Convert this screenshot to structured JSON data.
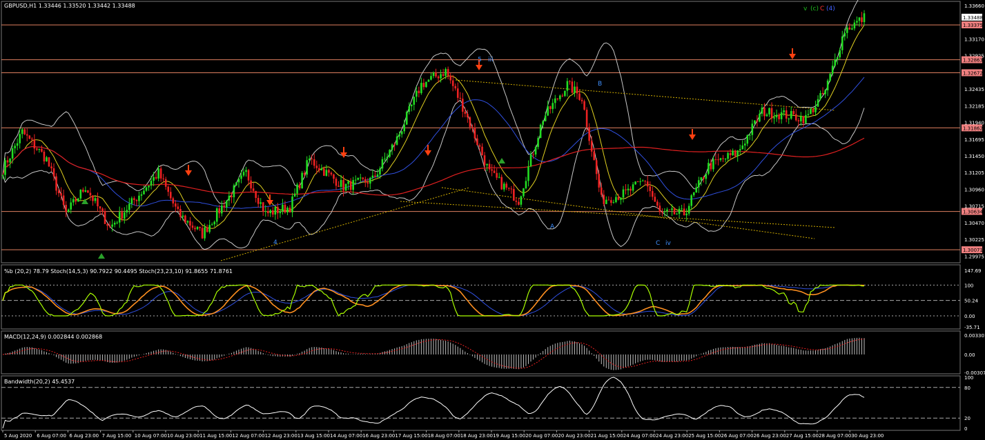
{
  "header": {
    "symbol_info": "GBPUSD,H1  1.33446 1.33520 1.33442 1.33488",
    "wave_count": [
      "v",
      "(c)",
      "C",
      "(4)"
    ],
    "wave_colors": [
      "#1fbf1f",
      "#1fbf1f",
      "#ff3030",
      "#4060ff"
    ]
  },
  "colors": {
    "bull": "#22dd22",
    "bear": "#ee2222",
    "hline": "#e08060",
    "ma_red": "#e02020",
    "ma_blue": "#3050e0",
    "ma_yellow": "#e0d020",
    "bands": "#c8c8c8",
    "stoch_fast": "#aaff00",
    "stoch_slow": "#ff9020",
    "macd_hist": "#c0c0c0",
    "macd_signal": "#ee2222",
    "arrow_down": "#ff4010",
    "arrow_up": "#2aa02a",
    "trend_yellow": "#d4b000"
  },
  "main_panel": {
    "price_ticks": [
      "1.33660",
      "1.33170",
      "1.32925",
      "1.32435",
      "1.32185",
      "1.31940",
      "1.31695",
      "1.31450",
      "1.31205",
      "1.30960",
      "1.30715",
      "1.30470",
      "1.30225",
      "1.29975"
    ],
    "price_boxes": [
      {
        "label": "1.33488",
        "bg": "#ffffff",
        "fg": "#000000"
      },
      {
        "label": "1.33375",
        "bg": "#f08080",
        "fg": "#000000"
      },
      {
        "label": "1.32863",
        "bg": "#f08080",
        "fg": "#000000"
      },
      {
        "label": "1.32672",
        "bg": "#f08080",
        "fg": "#000000"
      },
      {
        "label": "1.31862",
        "bg": "#f08080",
        "fg": "#000000"
      },
      {
        "label": "1.30634",
        "bg": "#f08080",
        "fg": "#000000"
      },
      {
        "label": "1.30071",
        "bg": "#f08080",
        "fg": "#000000"
      }
    ],
    "wave_labels": [
      {
        "text": "5",
        "color": "#4090ff"
      },
      {
        "text": "iii",
        "color": "#4090ff"
      },
      {
        "text": "B",
        "color": "#4090ff"
      },
      {
        "text": "A",
        "color": "#4090ff"
      },
      {
        "text": "C",
        "color": "#4090ff"
      },
      {
        "text": "iv",
        "color": "#4090ff"
      },
      {
        "text": "4",
        "color": "#4090ff"
      }
    ]
  },
  "stoch_panel": {
    "title": "%b (20,2) 78.79  Stoch(14,5,3) 90.7922 90.4495  Stoch(23,23,10) 91.8655 71.8761",
    "ticks": [
      "147.69",
      "100",
      "50.24",
      "0.00",
      "-35.71"
    ]
  },
  "macd_panel": {
    "title": "MACD(12,24,9) 0.002844 0.002868",
    "ticks": [
      "0.003301",
      "0.00",
      "-0.00307"
    ]
  },
  "bandwidth_panel": {
    "title": "Bandwidth(20,2) 45.4537",
    "ticks": [
      "100",
      "80",
      "20",
      "0"
    ]
  },
  "time_axis": [
    "5 Aug 2020",
    "6 Aug 07:00",
    "6 Aug 23:00",
    "7 Aug 15:00",
    "10 Aug 07:00",
    "10 Aug 23:00",
    "11 Aug 15:00",
    "12 Aug 07:00",
    "12 Aug 23:00",
    "13 Aug 15:00",
    "14 Aug 07:00",
    "16 Aug 23:00",
    "17 Aug 15:00",
    "18 Aug 07:00",
    "18 Aug 23:00",
    "19 Aug 15:00",
    "20 Aug 07:00",
    "20 Aug 23:00",
    "21 Aug 15:00",
    "24 Aug 07:00",
    "24 Aug 23:00",
    "25 Aug 15:00",
    "26 Aug 07:00",
    "26 Aug 23:00",
    "27 Aug 15:00",
    "28 Aug 07:00",
    "30 Aug 23:00"
  ],
  "chart_data": [
    {
      "type": "candlestick",
      "symbol": "GBPUSD",
      "timeframe": "H1",
      "ohlc_current": {
        "open": 1.33446,
        "high": 1.3352,
        "low": 1.33442,
        "close": 1.33488
      },
      "ylim": [
        1.299,
        1.337
      ],
      "horizontal_levels": [
        1.33375,
        1.32863,
        1.32672,
        1.31862,
        1.30634,
        1.30071
      ],
      "price_path": {
        "x_labels_index": "hours since start, approx",
        "anchors": [
          [
            0,
            1.3125
          ],
          [
            8,
            1.318
          ],
          [
            18,
            1.314
          ],
          [
            26,
            1.306
          ],
          [
            34,
            1.31
          ],
          [
            44,
            1.304
          ],
          [
            54,
            1.308
          ],
          [
            64,
            1.312
          ],
          [
            72,
            1.306
          ],
          [
            82,
            1.303
          ],
          [
            90,
            1.307
          ],
          [
            100,
            1.312
          ],
          [
            108,
            1.306
          ],
          [
            118,
            1.307
          ],
          [
            126,
            1.314
          ],
          [
            140,
            1.31
          ],
          [
            152,
            1.311
          ],
          [
            162,
            1.317
          ],
          [
            172,
            1.325
          ],
          [
            182,
            1.327
          ],
          [
            190,
            1.321
          ],
          [
            200,
            1.312
          ],
          [
            212,
            1.308
          ],
          [
            222,
            1.32
          ],
          [
            232,
            1.325
          ],
          [
            238,
            1.323
          ],
          [
            246,
            1.308
          ],
          [
            256,
            1.309
          ],
          [
            264,
            1.311
          ],
          [
            270,
            1.306
          ],
          [
            280,
            1.306
          ],
          [
            290,
            1.313
          ],
          [
            302,
            1.315
          ],
          [
            312,
            1.321
          ],
          [
            322,
            1.3205
          ],
          [
            330,
            1.32
          ],
          [
            338,
            1.324
          ],
          [
            346,
            1.333
          ],
          [
            354,
            1.3348
          ]
        ]
      },
      "moving_averages": [
        "red (long period)",
        "blue",
        "yellow"
      ],
      "bands": "Bollinger (20,2)",
      "markers": {
        "down_arrows": 8,
        "up_arrows": 3
      }
    },
    {
      "type": "line",
      "title": "%b (20,2) 78.79  Stoch(14,5,3) 90.7922 90.4495  Stoch(23,23,10) 91.8655 71.8761",
      "ylim": [
        -35.71,
        147.69
      ],
      "series": [
        {
          "name": "Stoch(14,5,3)",
          "last": 90.7922
        },
        {
          "name": "Stoch(23,23,10)",
          "last": 91.8655
        },
        {
          "name": "%b (20,2)",
          "last": 78.79
        }
      ]
    },
    {
      "type": "bar",
      "title": "MACD(12,24,9) 0.002844 0.002868",
      "ylim": [
        -0.00307,
        0.003301
      ],
      "series": [
        {
          "name": "MACD",
          "last": 0.002844
        },
        {
          "name": "Signal",
          "last": 0.002868
        }
      ]
    },
    {
      "type": "line",
      "title": "Bandwidth(20,2) 45.4537",
      "ylim": [
        0,
        100
      ],
      "series": [
        {
          "name": "Bandwidth(20,2)",
          "last": 45.4537
        }
      ]
    }
  ]
}
